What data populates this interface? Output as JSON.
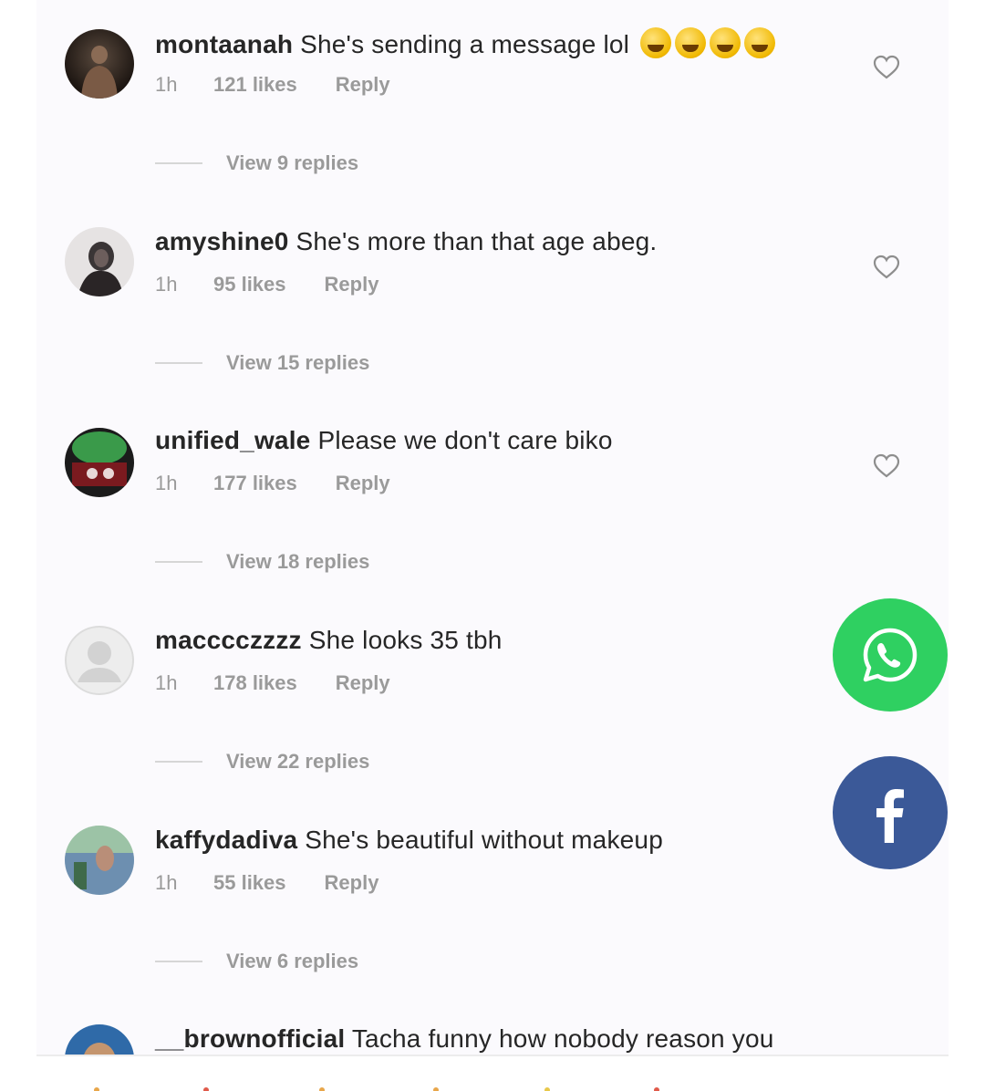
{
  "comments": [
    {
      "username": "montaanah",
      "text": "She's sending a message lol",
      "time": "1h",
      "likes": "121 likes",
      "reply": "Reply",
      "replies": "View 9 replies",
      "emoji_count": 4
    },
    {
      "username": "amyshine0",
      "text": "She's more than that age abeg.",
      "time": "1h",
      "likes": "95 likes",
      "reply": "Reply",
      "replies": "View 15 replies"
    },
    {
      "username": "unified_wale",
      "text": "Please we don't care biko",
      "time": "1h",
      "likes": "177 likes",
      "reply": "Reply",
      "replies": "View 18 replies"
    },
    {
      "username": "macccczzzz",
      "text": "She looks 35 tbh",
      "time": "1h",
      "likes": "178 likes",
      "reply": "Reply",
      "replies": "View 22 replies"
    },
    {
      "username": "kaffydadiva",
      "text": "She's beautiful without makeup",
      "time": "1h",
      "likes": "55 likes",
      "reply": "Reply",
      "replies": "View 6 replies"
    },
    {
      "username": "__brownofficial",
      "text": "Tacha funny how nobody reason you"
    }
  ],
  "share": {
    "whatsapp_color": "#2fd061",
    "facebook_color": "#3b5998"
  },
  "icons": {
    "heart": "heart-outline-icon",
    "whatsapp": "whatsapp-icon",
    "facebook": "facebook-icon"
  }
}
